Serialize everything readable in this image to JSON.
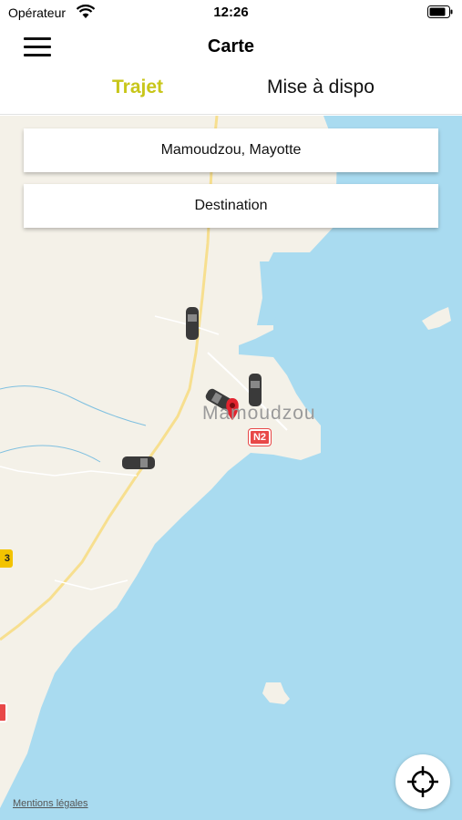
{
  "status_bar": {
    "carrier": "Opérateur",
    "time": "12:26",
    "wifi_icon": "wifi-icon",
    "battery_icon": "battery-icon"
  },
  "nav": {
    "title": "Carte",
    "menu_icon": "hamburger-menu-icon"
  },
  "tabs": [
    {
      "label": "Trajet",
      "active": true,
      "color": "#c8c61a"
    },
    {
      "label": "Mise à dispo",
      "active": false,
      "color": "#111111"
    }
  ],
  "search": {
    "origin_value": "Mamoudzou, Mayotte",
    "destination_placeholder": "Destination"
  },
  "map": {
    "city_label": "Mamoudzou",
    "road_badge": "N2",
    "road_badge_left": "3",
    "water_color": "#a9dbf0",
    "land_color": "#f4f1e8",
    "pin_color": "#e2232e",
    "cars": 4,
    "legal_link": "Mentions légales",
    "locate_icon": "crosshair-icon"
  }
}
